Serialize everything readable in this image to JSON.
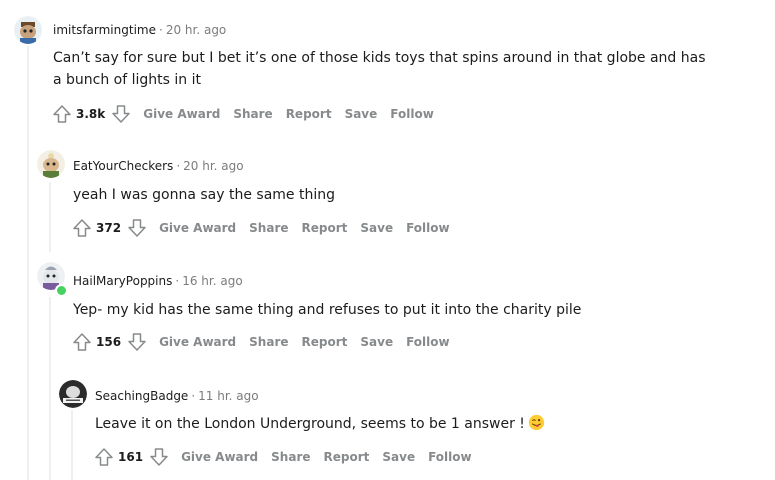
{
  "comments": [
    {
      "username": "imitsfarmingtime",
      "separator": "·",
      "time": "20 hr. ago",
      "body": "Can’t say for sure but I bet it’s one of those kids toys that spins around in that globe and has a bunch of lights in it",
      "score": "3.8k",
      "actions": [
        "Give Award",
        "Share",
        "Report",
        "Save",
        "Follow"
      ]
    },
    {
      "username": "EatYourCheckers",
      "separator": "·",
      "time": "20 hr. ago",
      "body": "yeah I was gonna say the same thing",
      "score": "372",
      "actions": [
        "Give Award",
        "Share",
        "Report",
        "Save",
        "Follow"
      ]
    },
    {
      "username": "HailMaryPoppins",
      "separator": "·",
      "time": "16 hr. ago",
      "body": "Yep- my kid has the same thing and refuses to put it into the charity pile",
      "score": "156",
      "actions": [
        "Give Award",
        "Share",
        "Report",
        "Save",
        "Follow"
      ]
    },
    {
      "username": "SeachingBadge",
      "separator": "·",
      "time": "11 hr. ago",
      "body": "Leave it on the London Underground, seems to be 1 answer !",
      "body_emoji": "winking-face-with-tongue",
      "score": "161",
      "actions": [
        "Give Award",
        "Share",
        "Report",
        "Save",
        "Follow"
      ]
    }
  ],
  "colors": {
    "text": "#1c1c1c",
    "muted": "#878a8c",
    "thread_line": "#edeff1",
    "online": "#46d160"
  },
  "icons": {
    "upvote": "upvote-arrow-icon",
    "downvote": "downvote-arrow-icon"
  }
}
